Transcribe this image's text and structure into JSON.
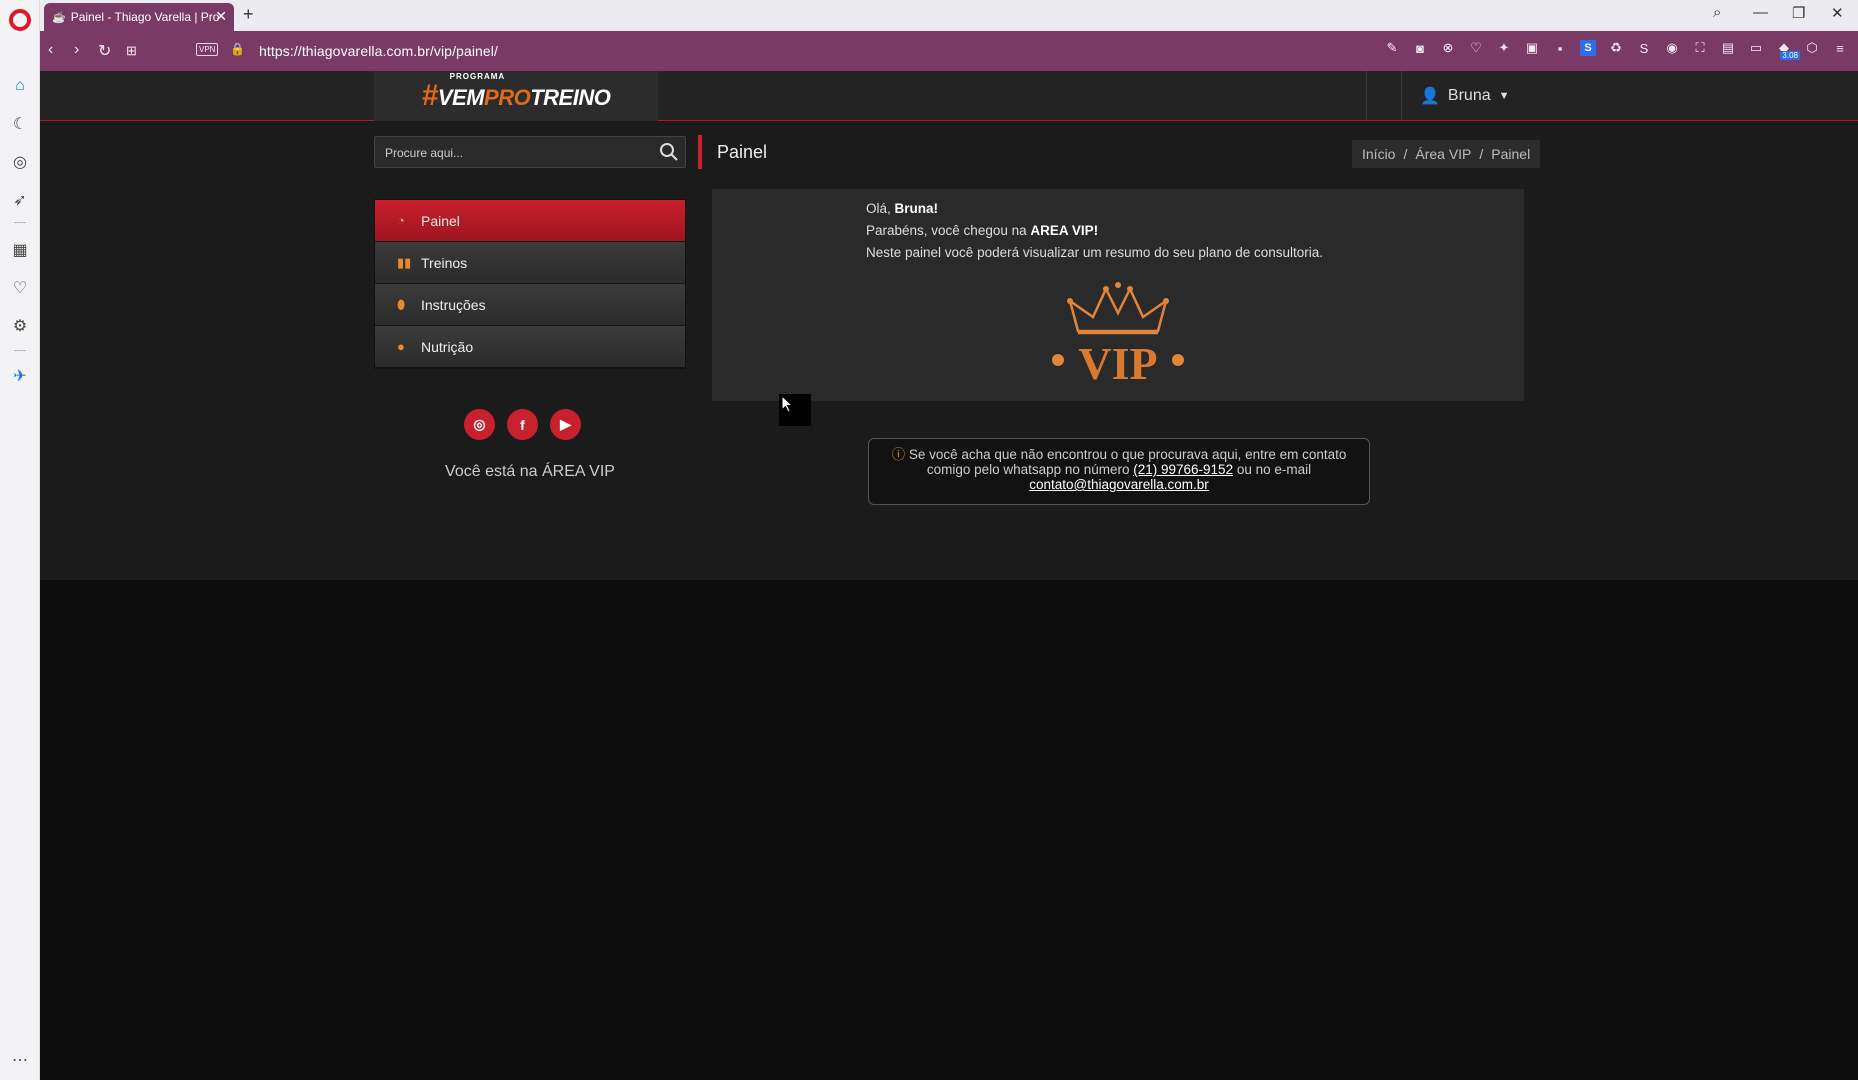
{
  "browser": {
    "tab_title": "Painel - Thiago Varella | Pro",
    "url": "https://thiagovarella.com.br/vip/painel/",
    "vpn_label": "VPN",
    "ext_badge": "3.08"
  },
  "site": {
    "logo": {
      "small": "PROGRAMA",
      "hash": "#",
      "vem": "VEM",
      "pro": "PRO",
      "treino": "TREINO"
    },
    "user_name": "Bruna",
    "search_placeholder": "Procure aqui...",
    "menu": [
      {
        "label": "Painel",
        "icon": "dashboard-icon"
      },
      {
        "label": "Treinos",
        "icon": "dumbbell-icon"
      },
      {
        "label": "Instruções",
        "icon": "pills-icon"
      },
      {
        "label": "Nutrição",
        "icon": "apple-icon"
      }
    ],
    "social": [
      "instagram-icon",
      "facebook-icon",
      "youtube-icon"
    ],
    "vip_note": "Você está na ÁREA VIP",
    "page_title": "Painel",
    "breadcrumb": [
      "Início",
      "/",
      "Área VIP",
      "/",
      "Painel"
    ],
    "welcome": {
      "greeting_prefix": "Olá,",
      "greeting_name": "Bruna!",
      "line2_prefix": "Parabéns, você chegou na",
      "line2_bold": "AREA VIP!",
      "line3": "Neste painel você poderá visualizar um resumo do seu plano de consultoria."
    },
    "vip_logo_text": "VIP",
    "help": {
      "text1": "Se você acha que não encontrou o que procurava aqui, entre em contato comigo pelo whatsapp no número",
      "phone": "(21) 99766-9152",
      "text2": "ou no e-mail",
      "email": "contato@thiagovarella.com.br"
    }
  },
  "colors": {
    "accent": "#c8202c",
    "orange": "#e68a2e",
    "chrome": "#7a3a66"
  }
}
